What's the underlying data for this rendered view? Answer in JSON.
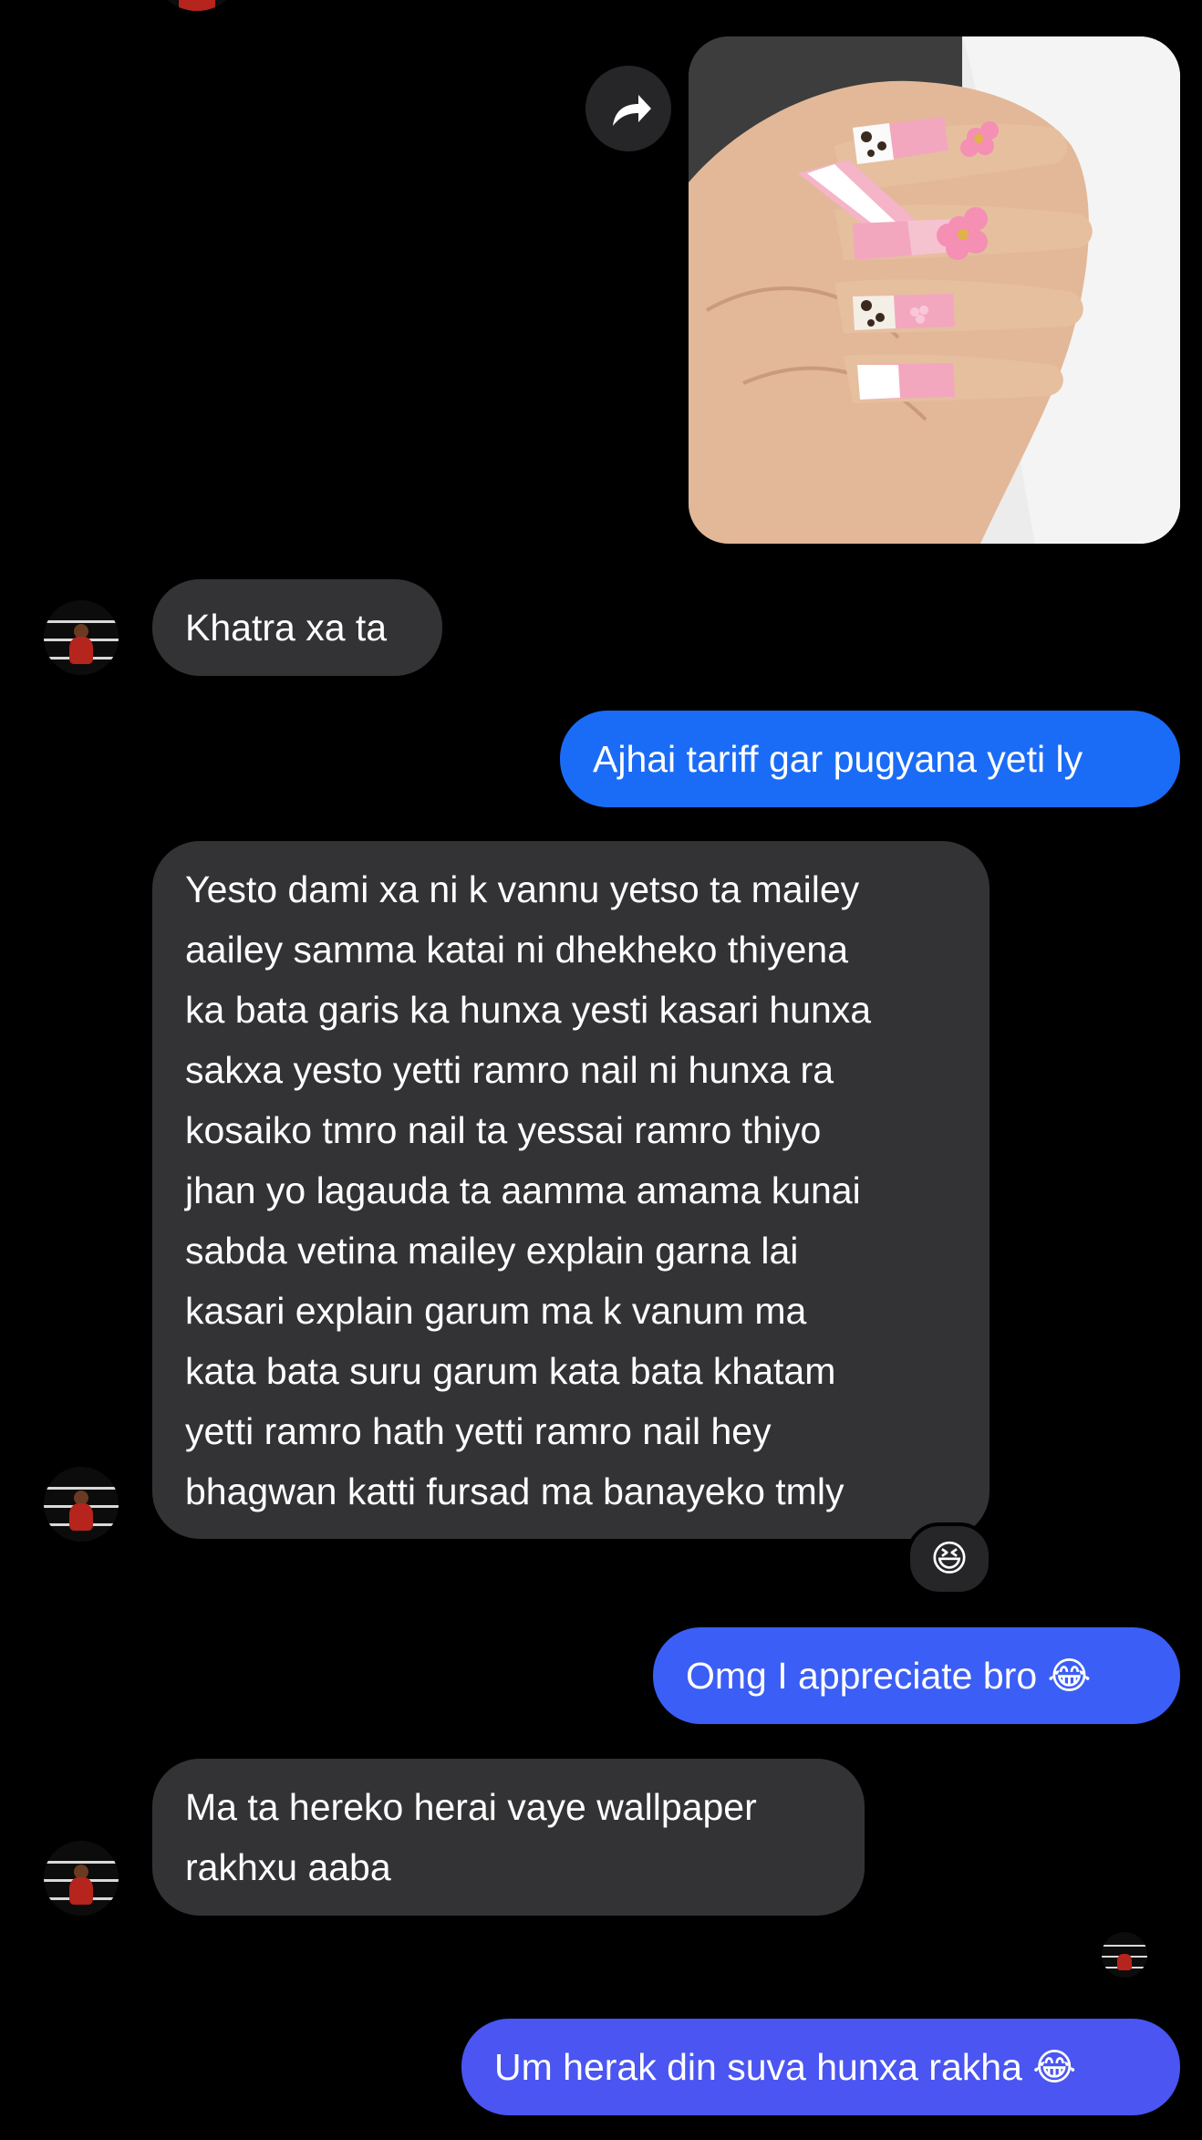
{
  "messages": [
    {
      "id": "m1",
      "from": "them",
      "text": "Khatra xa ta"
    },
    {
      "id": "m2",
      "from": "me",
      "text": "Ajhai tariff gar pugyana yeti ly"
    },
    {
      "id": "m3",
      "from": "them",
      "lines": [
        "Yesto dami xa ni k vannu yetso ta mailey",
        "aailey samma katai ni dhekheko thiyena",
        "ka bata garis ka hunxa yesti kasari hunxa",
        "sakxa yesto yetti ramro nail ni hunxa ra",
        "kosaiko tmro nail ta yessai ramro thiyo",
        "jhan yo lagauda ta aamma amama kunai",
        "sabda vetina mailey explain garna lai",
        "kasari explain garum ma k vanum ma",
        "kata bata suru garum kata bata khatam",
        "yetti ramro hath yetti ramro nail hey",
        "bhagwan katti fursad ma banayeko tmly"
      ],
      "reaction": "😆"
    },
    {
      "id": "m4",
      "from": "me",
      "text": "Omg I appreciate bro 😂"
    },
    {
      "id": "m5",
      "from": "them",
      "lines": [
        "Ma ta hereko herai vaye wallpaper",
        "rakhxu aaba"
      ]
    },
    {
      "id": "m6",
      "from": "me",
      "text": "Um herak din suva hunxa rakha 😂"
    }
  ],
  "icons": {
    "share": "share-arrow-icon",
    "avatar": "contact-avatar",
    "read_receipt": "read-receipt-avatar"
  },
  "colors": {
    "incoming_bubble": "#333335",
    "outgoing_top": "#1a6cf7",
    "outgoing_mid": "#3b5ef6",
    "outgoing_bottom": "#4a55f2",
    "background": "#000000"
  }
}
